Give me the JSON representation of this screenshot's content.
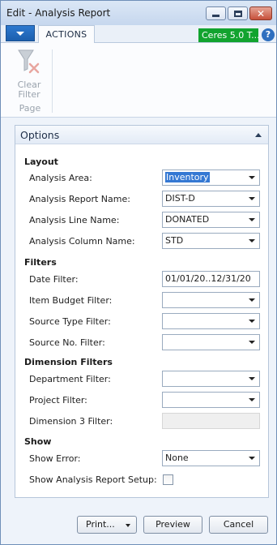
{
  "window": {
    "title": "Edit - Analysis Report"
  },
  "ribbon": {
    "tab_actions": "ACTIONS",
    "company": "Ceres 5.0 T...",
    "help": "?",
    "clear_filter": "Clear Filter",
    "group_label": "Page"
  },
  "panel": {
    "title": "Options",
    "sections": {
      "layout": "Layout",
      "filters": "Filters",
      "dimension_filters": "Dimension Filters",
      "show": "Show"
    },
    "fields": {
      "analysis_area": {
        "label": "Analysis Area:",
        "value": "Inventory"
      },
      "analysis_report_name": {
        "label": "Analysis Report Name:",
        "value": "DIST-D"
      },
      "analysis_line_name": {
        "label": "Analysis Line Name:",
        "value": "DONATED"
      },
      "analysis_column_name": {
        "label": "Analysis Column Name:",
        "value": "STD"
      },
      "date_filter": {
        "label": "Date Filter:",
        "value": "01/01/20..12/31/20"
      },
      "item_budget_filter": {
        "label": "Item Budget Filter:",
        "value": ""
      },
      "source_type_filter": {
        "label": "Source Type Filter:",
        "value": ""
      },
      "source_no_filter": {
        "label": "Source No. Filter:",
        "value": ""
      },
      "department_filter": {
        "label": "Department Filter:",
        "value": ""
      },
      "project_filter": {
        "label": "Project Filter:",
        "value": ""
      },
      "dimension3_filter": {
        "label": "Dimension 3 Filter:",
        "value": ""
      },
      "show_error": {
        "label": "Show Error:",
        "value": "None"
      },
      "show_setup": {
        "label": "Show Analysis Report Setup:",
        "checked": false
      }
    }
  },
  "buttons": {
    "print": "Print...",
    "preview": "Preview",
    "cancel": "Cancel"
  },
  "colors": {
    "accent": "#1c5fae",
    "company_badge": "#12a32f",
    "selection": "#3478d3"
  }
}
